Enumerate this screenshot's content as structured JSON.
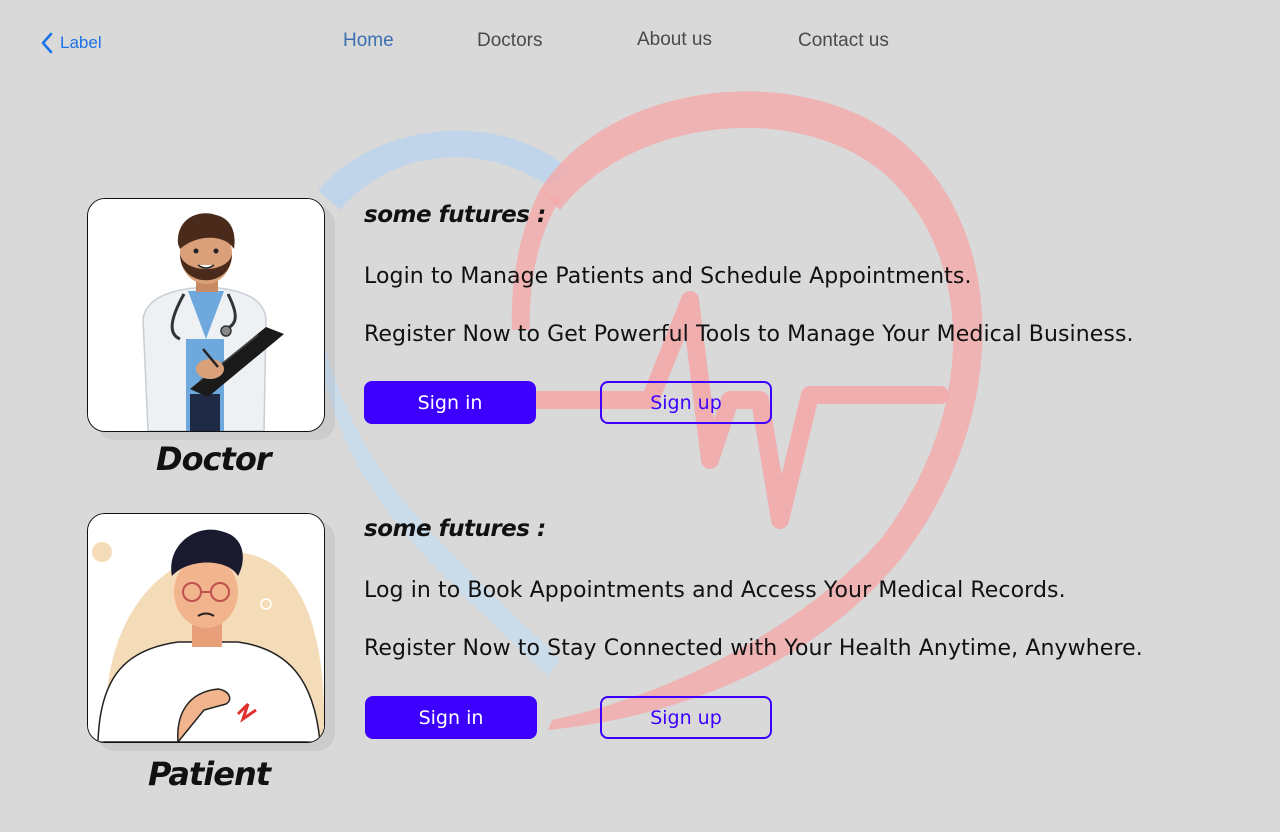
{
  "header": {
    "back_label": "Label",
    "nav": [
      {
        "label": "Home",
        "active": true
      },
      {
        "label": "Doctors",
        "active": false
      },
      {
        "label": "About us",
        "active": false
      },
      {
        "label": "Contact us",
        "active": false
      }
    ]
  },
  "doctor": {
    "role_label": "Doctor",
    "features_title": "some futures :",
    "features": [
      "Login to Manage Patients and Schedule Appointments.",
      "Register Now to Get Powerful Tools to Manage Your Medical Business."
    ],
    "signin_label": "Sign in",
    "signup_label": "Sign up"
  },
  "patient": {
    "role_label": "Patient",
    "features_title": "some futures :",
    "features": [
      "Log in to Book Appointments and Access Your Medical Records.",
      "Register Now to Stay Connected with Your Health Anytime, Anywhere."
    ],
    "signin_label": "Sign in",
    "signup_label": "Sign up"
  },
  "colors": {
    "background": "#d9d9d9",
    "primary": "#3d00ff",
    "link": "#1a73e8",
    "nav_active": "#3a6fb0",
    "logo_red": "#f4a6a6",
    "logo_blue": "#b9d3ee"
  },
  "icons": {
    "back": "chevron-left-icon",
    "background_logo": "heart-pulse-logo"
  }
}
